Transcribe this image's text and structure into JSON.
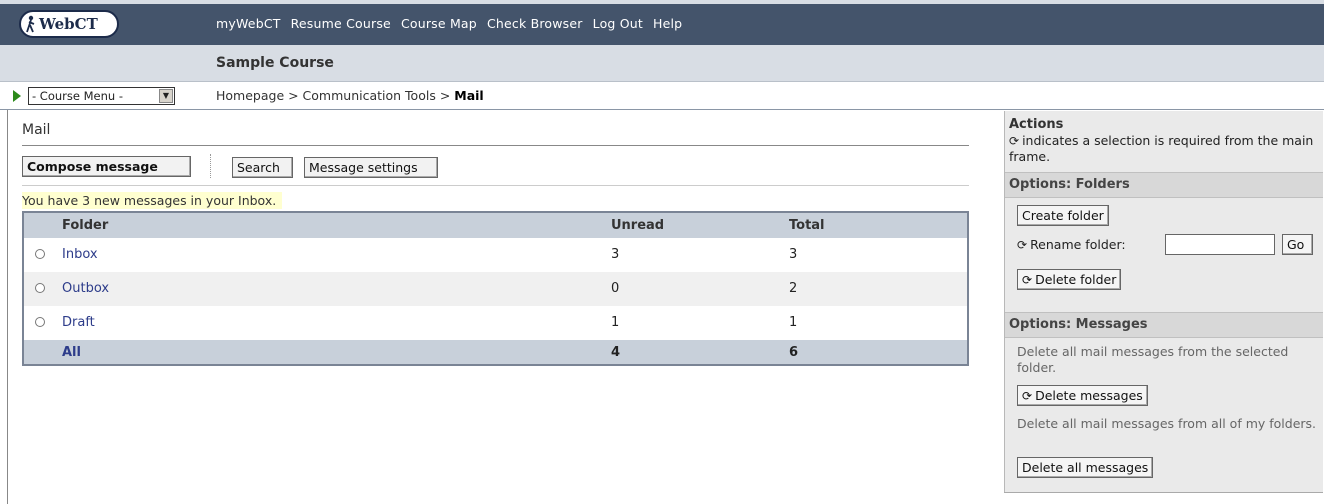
{
  "logo": {
    "text": "WebCT"
  },
  "topnav": [
    "myWebCT",
    "Resume Course",
    "Course Map",
    "Check Browser",
    "Log Out",
    "Help"
  ],
  "course": {
    "title": "Sample Course"
  },
  "course_menu": {
    "selected": "- Course Menu -"
  },
  "breadcrumb": {
    "part1": "Homepage > Communication Tools > ",
    "current": "Mail"
  },
  "main": {
    "title": "Mail",
    "buttons": {
      "compose": "Compose message",
      "search": "Search",
      "settings": "Message settings"
    },
    "notice": "You have 3 new messages in your Inbox.",
    "table": {
      "headers": {
        "folder": "Folder",
        "unread": "Unread",
        "total": "Total"
      },
      "rows": [
        {
          "folder": "Inbox",
          "unread": "3",
          "total": "3"
        },
        {
          "folder": "Outbox",
          "unread": "0",
          "total": "2"
        },
        {
          "folder": "Draft",
          "unread": "1",
          "total": "1"
        }
      ],
      "summary": {
        "folder": "All",
        "unread": "4",
        "total": "6"
      }
    }
  },
  "actions": {
    "title": "Actions",
    "note": "indicates a selection is required from the main frame.",
    "folders": {
      "heading": "Options: Folders",
      "create": "Create folder",
      "rename_label": "Rename folder:",
      "rename_value": "",
      "go": "Go",
      "delete": "Delete folder"
    },
    "messages": {
      "heading": "Options: Messages",
      "desc1": "Delete all mail messages from the selected folder.",
      "delete": "Delete messages",
      "desc2": "Delete all mail messages from all of my folders.",
      "delete_all": "Delete all messages"
    }
  },
  "colors": {
    "topbar": "#44546b",
    "coursebar": "#d8dde4",
    "table_header": "#c8d0da",
    "link": "#2d3c8a",
    "notice": "#ffffd0"
  },
  "icons": {
    "selection_required": "arrow-into-circle-icon"
  }
}
